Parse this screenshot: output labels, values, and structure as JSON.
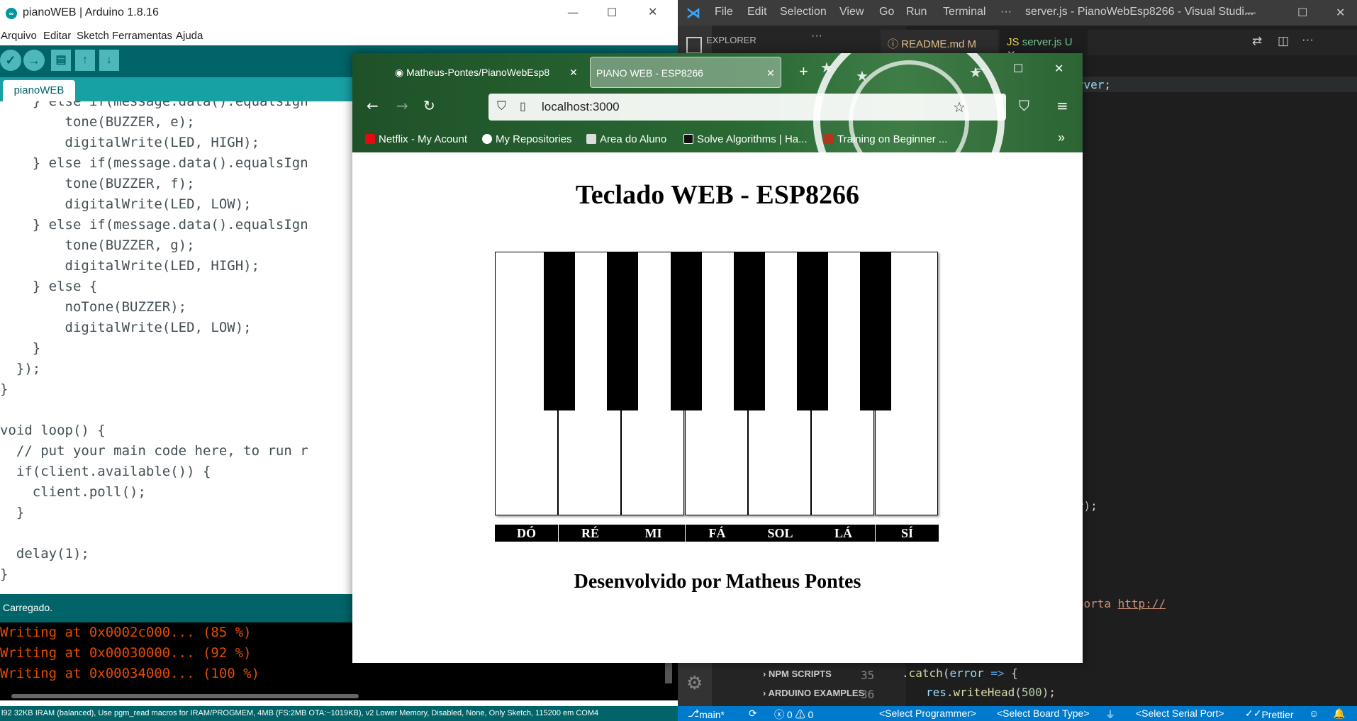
{
  "arduino": {
    "title": "pianoWEB | Arduino 1.8.16",
    "menu": [
      "Arquivo",
      "Editar",
      "Sketch",
      "Ferramentas",
      "Ajuda"
    ],
    "tab": "pianoWEB",
    "status": "Carregado.",
    "console": [
      "Writing at 0x0002c000... (85 %)",
      "Writing at 0x00030000... (92 %)",
      "Writing at 0x00034000... (100 %)"
    ],
    "footer": "l92 32KB IRAM (balanced), Use pgm_read macros for IRAM/PROGMEM, 4MB (FS:2MB OTA:~1019KB), v2 Lower Memory, Disabled, None, Only Sketch, 115200 em COM4",
    "code": {
      "l1": "    } else if(message.data().equalsIgn",
      "l2": "        tone(BUZZER, e);",
      "l3": "        digitalWrite(LED, HIGH);",
      "l4": "    } else if(message.data().equalsIgn",
      "l5": "        tone(BUZZER, f);",
      "l6": "        digitalWrite(LED, LOW);",
      "l7": "    } else if(message.data().equalsIgn",
      "l8": "        tone(BUZZER, g);",
      "l9": "        digitalWrite(LED, HIGH);",
      "l10": "    } else {",
      "l11": "        noTone(BUZZER);",
      "l12": "        digitalWrite(LED, LOW);",
      "l13": "    }",
      "l14": "  });",
      "l15": "}",
      "l16": "",
      "l17": "void loop() {",
      "l18": "  // put your main code here, to run r",
      "l19": "  if(client.available()) {",
      "l20": "    client.poll();",
      "l21": "  }",
      "l22": "",
      "l23": "  delay(1);",
      "l24": "}"
    }
  },
  "vscode": {
    "menu": [
      "File",
      "Edit",
      "Selection",
      "View",
      "Go",
      "Run",
      "Terminal",
      "···"
    ],
    "title": "server.js - PianoWebEsp8266 - Visual Studi...",
    "explorer": "EXPLORER",
    "tabs": [
      {
        "label": "README.md",
        "badge": "M"
      },
      {
        "label": "server.js",
        "badge": "U"
      }
    ],
    "sidebar_sections": [
      "NPM SCRIPTS",
      "ARDUINO EXAMPLES"
    ],
    "status": {
      "branch": "main*",
      "problems": "ⓧ 0  ⚠ 0",
      "programmer": "<Select Programmer>",
      "board": "<Select Board Type>",
      "serial": "<Select Serial Port>",
      "prettier": "Prettier"
    },
    "line_numbers": [
      "35",
      "36"
    ]
  },
  "firefox": {
    "tabs": [
      {
        "label": "Matheus-Pontes/PianoWebEsp8"
      },
      {
        "label": "PIANO WEB - ESP8266"
      }
    ],
    "url": "localhost:3000",
    "bookmarks": [
      "Netflix - My Acount",
      "My Repositories",
      "Area do Aluno",
      "Solve Algorithms | Ha...",
      "Training on Beginner ..."
    ]
  },
  "page": {
    "heading": "Teclado WEB - ESP8266",
    "keys": [
      "DÓ",
      "RÉ",
      "MI",
      "FÁ",
      "SOL",
      "LÁ",
      "SÍ"
    ],
    "footer": "Desenvolvido por Matheus Pontes"
  },
  "colors": {
    "arduino_teal": "#006468",
    "arduino_tab_bar": "#17a1a5",
    "vscode_status": "#007acc",
    "firefox_theme_green": "#2a6a34"
  }
}
